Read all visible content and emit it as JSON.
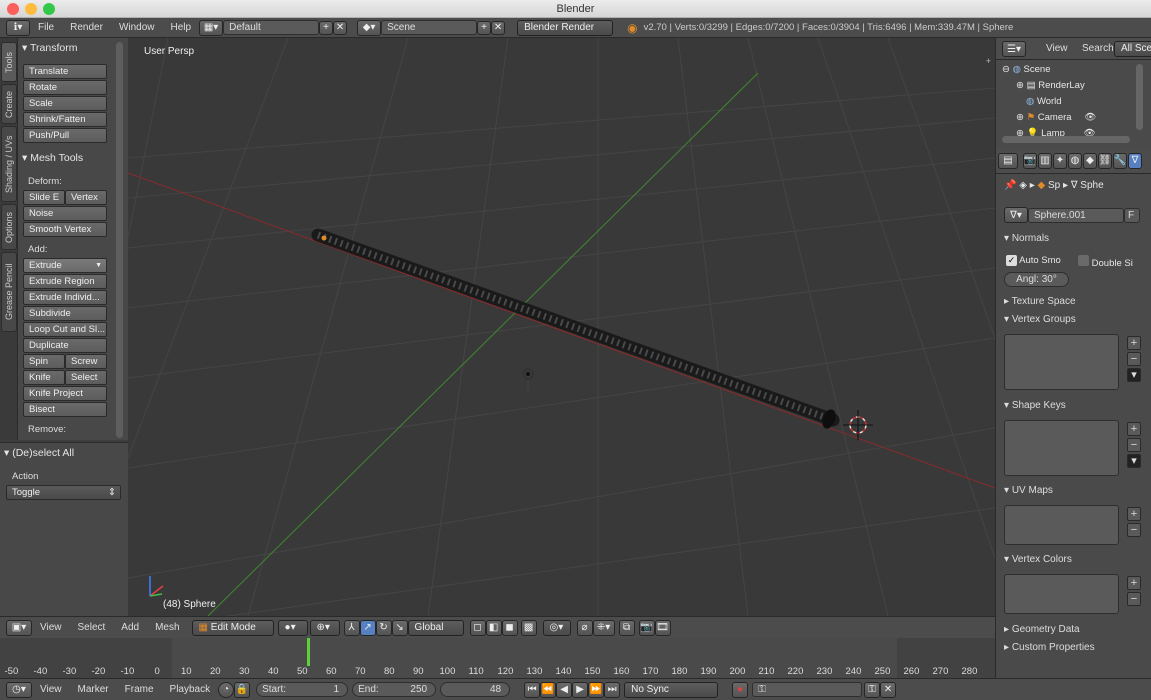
{
  "window": {
    "title": "Blender"
  },
  "infobar": {
    "menus": [
      "File",
      "Render",
      "Window",
      "Help"
    ],
    "screen_layout": "Default",
    "scene": "Scene",
    "engine": "Blender Render",
    "stats": "v2.70 | Verts:0/3299 | Edges:0/7200 | Faces:0/3904 | Tris:6496 | Mem:339.47M | Sphere"
  },
  "tabs": [
    "Tools",
    "Create",
    "Shading / UVs",
    "Options",
    "Grease Pencil"
  ],
  "toolshelf": {
    "transform": {
      "header": "Transform",
      "buttons": [
        "Translate",
        "Rotate",
        "Scale",
        "Shrink/Fatten",
        "Push/Pull"
      ]
    },
    "mesh_tools": {
      "header": "Mesh Tools",
      "deform_label": "Deform:",
      "slide_e": "Slide E",
      "vertex": "Vertex",
      "noise": "Noise",
      "smooth_vertex": "Smooth Vertex",
      "add_label": "Add:",
      "extrude": "Extrude",
      "extrude_region": "Extrude Region",
      "extrude_individual": "Extrude Individ...",
      "subdivide": "Subdivide",
      "loop_cut": "Loop Cut and Sl...",
      "duplicate": "Duplicate",
      "spin": "Spin",
      "screw": "Screw",
      "knife": "Knife",
      "select": "Select",
      "knife_project": "Knife Project",
      "bisect": "Bisect",
      "remove_label": "Remove:"
    }
  },
  "operator": {
    "header": "(De)select All",
    "action_label": "Action",
    "action_value": "Toggle"
  },
  "viewport": {
    "view_name": "User Persp",
    "object_label": "(48) Sphere"
  },
  "view_header": {
    "menus": [
      "View",
      "Select",
      "Add",
      "Mesh"
    ],
    "mode": "Edit Mode",
    "orientation": "Global"
  },
  "timeline": {
    "ticks": [
      "-50",
      "-40",
      "-30",
      "-20",
      "-10",
      "0",
      "10",
      "20",
      "30",
      "40",
      "50",
      "60",
      "70",
      "80",
      "90",
      "100",
      "110",
      "120",
      "130",
      "140",
      "150",
      "160",
      "170",
      "180",
      "190",
      "200",
      "210",
      "220",
      "230",
      "240",
      "250",
      "260",
      "270",
      "280"
    ],
    "current_frame": 48,
    "menus": [
      "View",
      "Marker",
      "Frame",
      "Playback"
    ],
    "start_label": "Start:",
    "start": "1",
    "end_label": "End:",
    "end": "250",
    "current": "48",
    "sync": "No Sync"
  },
  "outliner": {
    "menus": [
      "View",
      "Search"
    ],
    "filter": "All Sce",
    "items": [
      "Scene",
      "RenderLay",
      "World",
      "Camera",
      "Lamp"
    ]
  },
  "properties": {
    "breadcrumb_obj": "Sp",
    "breadcrumb_mesh": "Sphe",
    "mesh_name": "Sphere.001",
    "fake_user": "F",
    "normals": "Normals",
    "auto_smooth": "Auto Smo",
    "double_sided": "Double Si",
    "angle": "Angl:  30°",
    "texture_space": "Texture Space",
    "vertex_groups": "Vertex Groups",
    "shape_keys": "Shape Keys",
    "uv_maps": "UV Maps",
    "vertex_colors": "Vertex Colors",
    "geometry_data": "Geometry Data",
    "custom_properties": "Custom Properties"
  }
}
